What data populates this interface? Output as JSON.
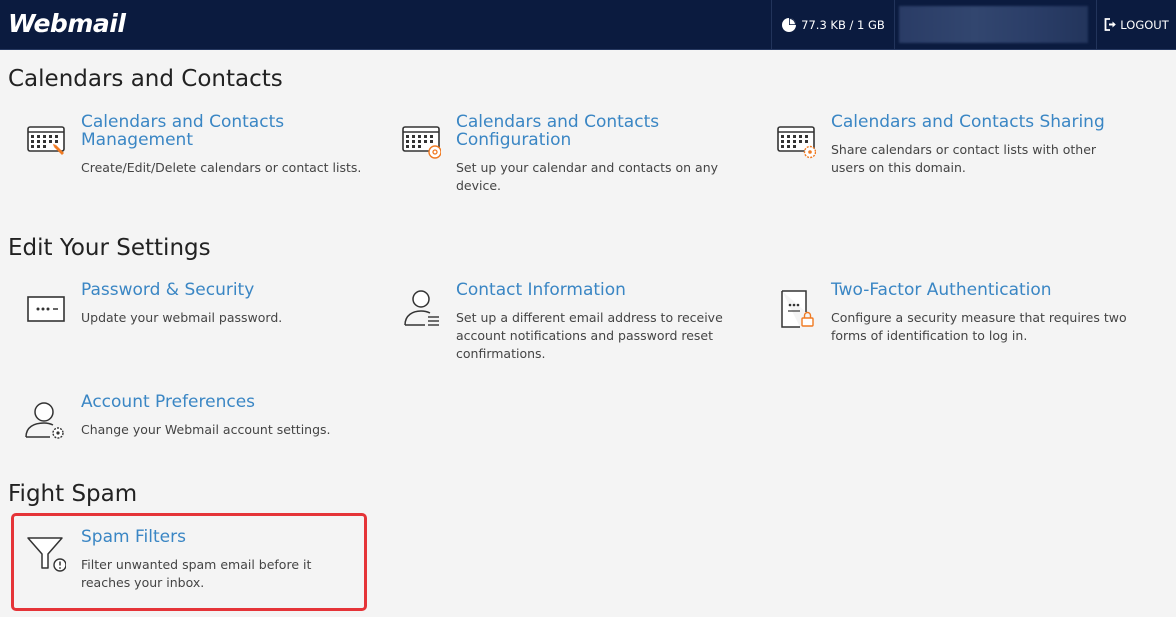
{
  "header": {
    "logo": "Webmail",
    "quota": "77.3 KB / 1 GB",
    "logout": "LOGOUT"
  },
  "sections": {
    "calendars": {
      "title": "Calendars and Contacts",
      "items": [
        {
          "title": "Calendars and Contacts Management",
          "desc": "Create/Edit/Delete calendars or contact lists."
        },
        {
          "title": "Calendars and Contacts Configuration",
          "desc": "Set up your calendar and contacts on any device."
        },
        {
          "title": "Calendars and Contacts Sharing",
          "desc": "Share calendars or contact lists with other users on this domain."
        }
      ]
    },
    "settings": {
      "title": "Edit Your Settings",
      "items": [
        {
          "title": "Password & Security",
          "desc": "Update your webmail password."
        },
        {
          "title": "Contact Information",
          "desc": "Set up a different email address to receive account notifications and password reset confirmations."
        },
        {
          "title": "Two-Factor Authentication",
          "desc": "Configure a security measure that requires two forms of identification to log in."
        },
        {
          "title": "Account Preferences",
          "desc": "Change your Webmail account settings."
        }
      ]
    },
    "spam": {
      "title": "Fight Spam",
      "items": [
        {
          "title": "Spam Filters",
          "desc": "Filter unwanted spam email before it reaches your inbox."
        }
      ]
    }
  },
  "colors": {
    "header_bg": "#0b1b3f",
    "link": "#3a86c4",
    "highlight": "#e53438",
    "accent_orange": "#f07a22"
  }
}
